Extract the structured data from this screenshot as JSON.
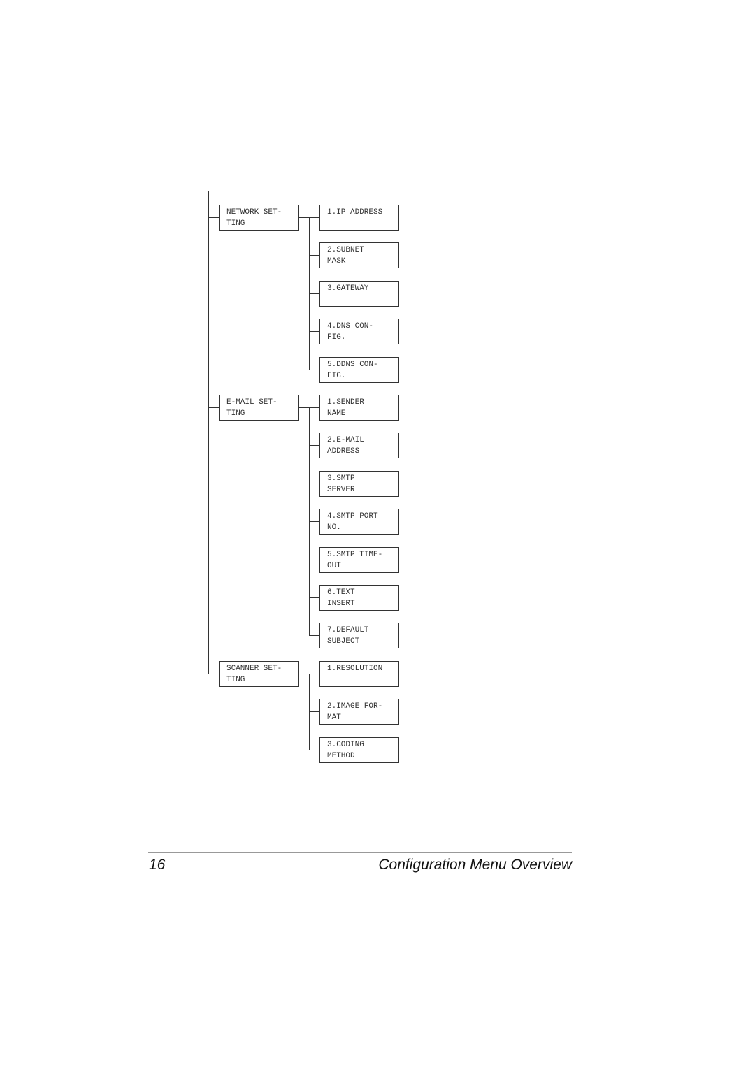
{
  "menu_tree": [
    {
      "label": [
        "NETWORK SET-",
        "TING"
      ],
      "children": [
        [
          "1.IP ADDRESS"
        ],
        [
          "2.SUBNET",
          "MASK"
        ],
        [
          "3.GATEWAY"
        ],
        [
          "4.DNS CON-",
          "FIG."
        ],
        [
          "5.DDNS CON-",
          "FIG."
        ]
      ]
    },
    {
      "label": [
        "E-MAIL SET-",
        "TING"
      ],
      "children": [
        [
          "1.SENDER",
          "NAME"
        ],
        [
          "2.E-MAIL",
          "ADDRESS"
        ],
        [
          "3.SMTP",
          "SERVER"
        ],
        [
          "4.SMTP PORT",
          "NO."
        ],
        [
          "5.SMTP TIME-",
          "OUT"
        ],
        [
          "6.TEXT",
          "INSERT"
        ],
        [
          "7.DEFAULT",
          "SUBJECT"
        ]
      ]
    },
    {
      "label": [
        "SCANNER SET-",
        "TING"
      ],
      "children": [
        [
          "1.RESOLUTION"
        ],
        [
          "2.IMAGE FOR-",
          "MAT"
        ],
        [
          "3.CODING",
          "METHOD"
        ]
      ]
    }
  ],
  "footer": {
    "page_number": "16",
    "section_title": "Configuration Menu Overview"
  }
}
